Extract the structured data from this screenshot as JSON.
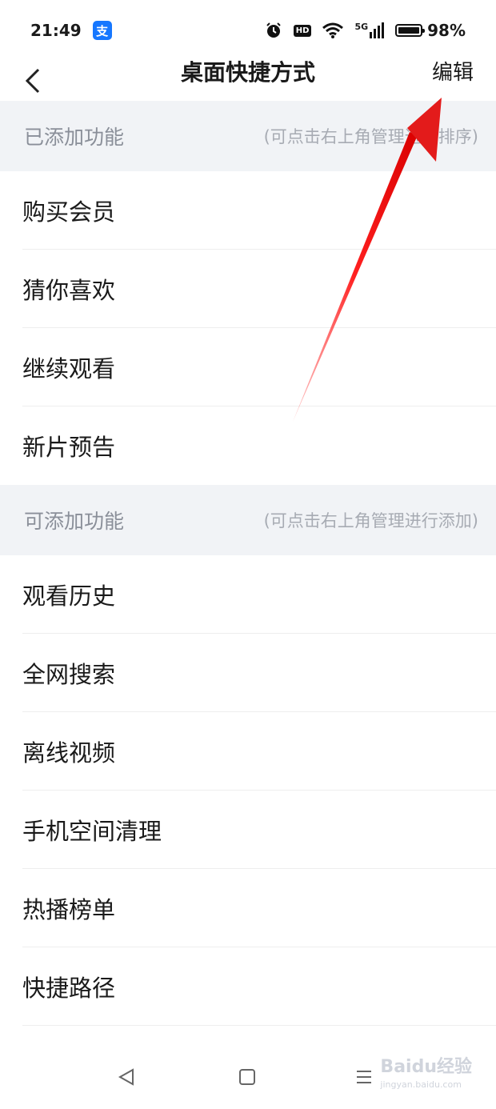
{
  "status": {
    "time": "21:49",
    "alipay_glyph": "支",
    "hd_label": "HD",
    "signal_label": "5G",
    "battery": "98%",
    "battery_level": 0.98
  },
  "nav": {
    "title": "桌面快捷方式",
    "edit_label": "编辑",
    "back_icon": "chevron-left-icon"
  },
  "added_section": {
    "title": "已添加功能",
    "hint": "(可点击右上角管理进行排序)",
    "items": [
      "购买会员",
      "猜你喜欢",
      "继续观看",
      "新片预告"
    ]
  },
  "available_section": {
    "title": "可添加功能",
    "hint": "(可点击右上角管理进行添加)",
    "items": [
      "观看历史",
      "全网搜索",
      "离线视频",
      "手机空间清理",
      "热播榜单",
      "快捷路径"
    ]
  },
  "watermark": {
    "text": "Baidu经验",
    "sub": "jingyan.baidu.com"
  },
  "colors": {
    "section_bg": "#f1f3f6",
    "arrow": "#e31b1b",
    "alipay": "#1677ff"
  }
}
